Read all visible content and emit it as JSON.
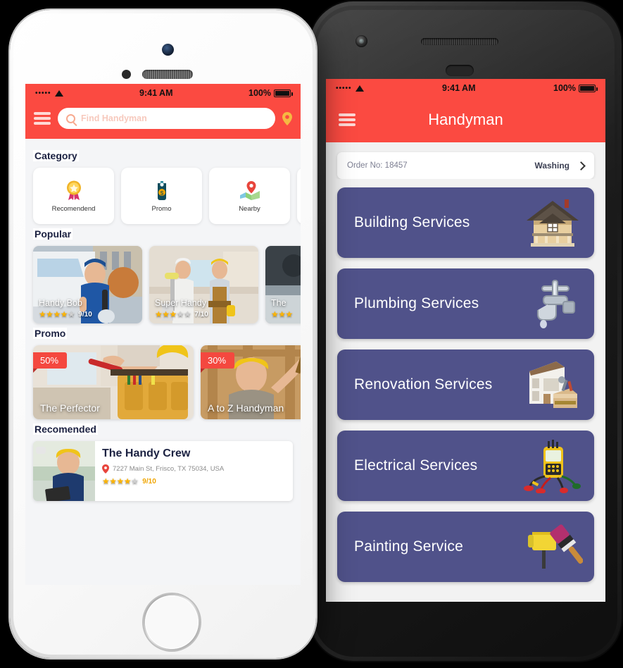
{
  "colors": {
    "accent_red": "#fb4a41",
    "card_purple": "#50528a",
    "screen_bg": "#f4f5f7",
    "star_on": "#ffb400",
    "star_off": "#cfcfcf",
    "title_navy": "#1b2141"
  },
  "left_phone": {
    "status_bar": {
      "signal": "•••••",
      "wifi_icon": "wifi-icon",
      "time": "9:41 AM",
      "battery_percent": "100%",
      "battery_icon": "battery-full-icon"
    },
    "header": {
      "menu_icon": "hamburger-menu-icon",
      "search_placeholder": "Find Handyman",
      "search_icon": "search-icon",
      "location_icon": "location-pin-icon"
    },
    "sections": {
      "category_title": "Category",
      "popular_title": "Popular",
      "promo_title": "Promo",
      "recommended_title": "Recomended"
    },
    "categories": [
      {
        "label": "Recomendend",
        "icon": "award-ribbon-icon"
      },
      {
        "label": "Promo",
        "icon": "price-tag-icon"
      },
      {
        "label": "Nearby",
        "icon": "map-pin-icon"
      },
      {
        "label": "",
        "icon": "partial-card"
      }
    ],
    "popular": [
      {
        "name": "Handy Bob",
        "stars": 4,
        "score": "9/10"
      },
      {
        "name": "Super Handy",
        "stars": 3,
        "score": "7/10"
      },
      {
        "name": "The",
        "stars": 3,
        "score": ""
      }
    ],
    "promos": [
      {
        "name": "The Perfector",
        "discount": "50%"
      },
      {
        "name": "A to Z Handyman",
        "discount": "30%"
      }
    ],
    "recommended": {
      "name": "The Handy Crew",
      "address": "7227 Main St, Frisco, TX 75034, USA",
      "address_icon": "location-pin-icon",
      "stars": 4,
      "score": "9/10"
    }
  },
  "right_phone": {
    "status_bar": {
      "signal": "•••••",
      "wifi_icon": "wifi-icon",
      "time": "9:41 AM",
      "battery_percent": "100%",
      "battery_icon": "battery-full-icon"
    },
    "header": {
      "menu_icon": "hamburger-menu-icon",
      "title": "Handyman"
    },
    "order": {
      "label": "Order No: 18457",
      "status": "Washing",
      "chevron_icon": "chevron-right-icon"
    },
    "services": [
      {
        "label": "Building Services",
        "icon": "house-icon"
      },
      {
        "label": "Plumbing Services",
        "icon": "faucet-icon"
      },
      {
        "label": "Renovation Services",
        "icon": "renovation-house-toolbox-icon"
      },
      {
        "label": "Electrical Services",
        "icon": "multimeter-icon"
      },
      {
        "label": "Painting Service",
        "icon": "paint-roller-brush-icon"
      }
    ]
  }
}
